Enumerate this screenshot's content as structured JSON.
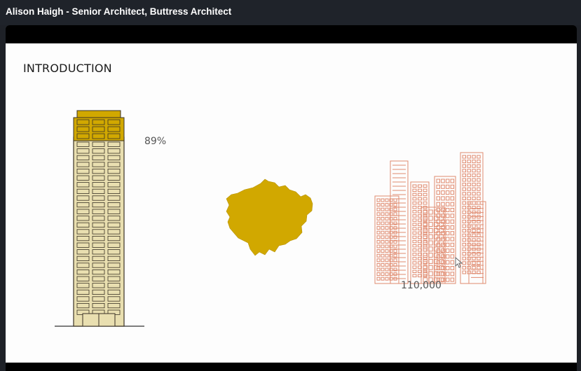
{
  "window": {
    "title": "Alison Haigh - Senior Architect, Buttress Architect"
  },
  "slide": {
    "heading": "INTRODUCTION",
    "tower_stat": "89%",
    "cluster_stat": "110,000",
    "colors": {
      "gold": "#d1a800",
      "tower_fill": "#e9dfb0",
      "outline": "#3a3226",
      "cluster_line": "#e08a6f",
      "slide_bg": "#fdfdfd"
    },
    "icons": [
      "tower-block-icon",
      "london-map-icon",
      "building-cluster-icon",
      "mouse-cursor-icon"
    ]
  }
}
